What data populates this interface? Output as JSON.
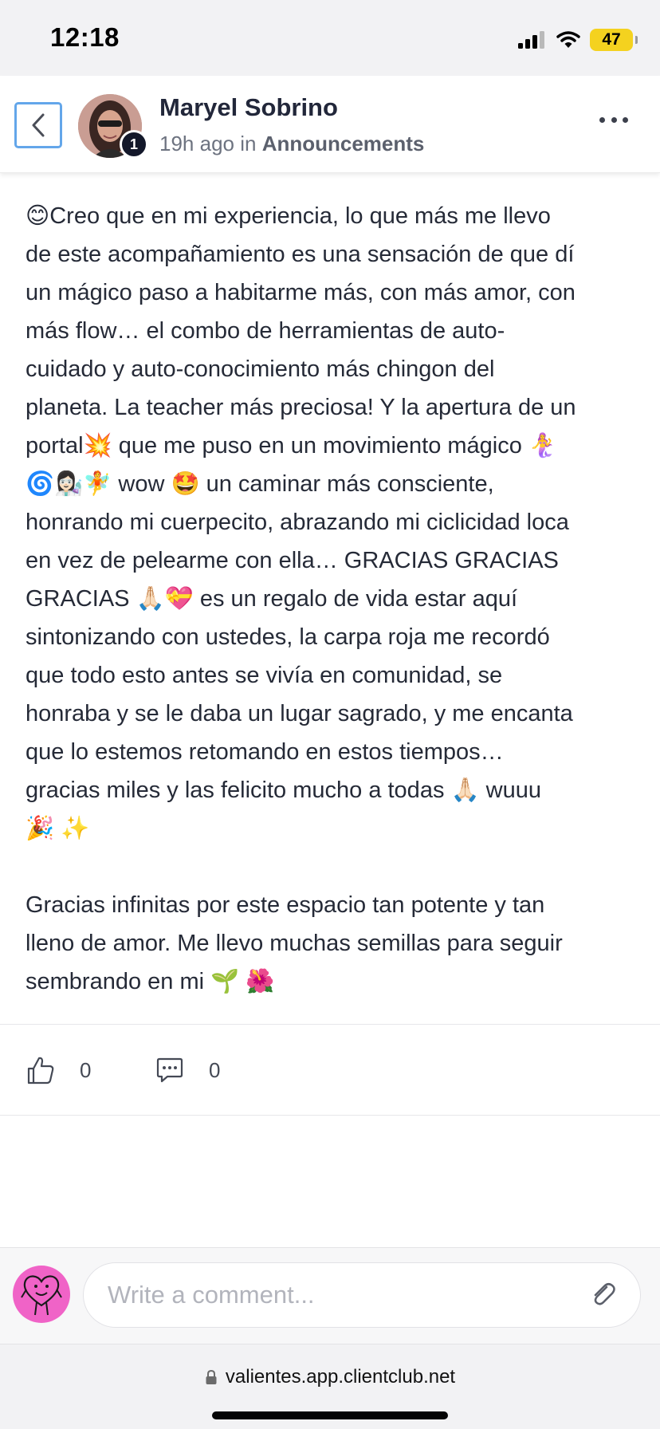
{
  "status_bar": {
    "time": "12:18",
    "battery": "47",
    "icons": [
      "signal-icon",
      "wifi-icon",
      "battery-icon"
    ]
  },
  "header": {
    "back_icon": "chevron-left-icon",
    "author_name": "Maryel Sobrino",
    "avatar_badge": "1",
    "time_ago": "19h ago",
    "in_word": "in",
    "category": "Announcements",
    "more_icon": "more-horizontal-icon"
  },
  "post": {
    "paragraphs": [
      "😊Creo que en mi experiencia, lo que más me llevo\nde este acompañamiento es una sensación de que dí\nun mágico paso a habitarme más, con más amor, con\nmás flow… el combo de herramientas de auto-\ncuidado y auto-conocimiento más chingon del\nplaneta. La teacher más preciosa! Y la apertura de un\nportal💥 que me puso en un movimiento mágico 🧜‍♀️\n🌀👩🏻‍🔬🧚 wow 🤩 un caminar más consciente,\nhonrando mi cuerpecito, abrazando mi ciclicidad loca\nen vez de pelearme con ella… GRACIAS GRACIAS\nGRACIAS 🙏🏻💝 es un regalo de vida estar aquí\nsintonizando con ustedes, la carpa roja me recordó\nque todo esto antes se vivía en comunidad, se\nhonraba y se le daba un lugar sagrado, y me encanta\nque lo estemos retomando en estos tiempos…\ngracias miles y las felicito mucho a todas 🙏🏻 wuuu\n🎉 ✨",
      "Gracias infinitas por este espacio tan potente y tan\nlleno de amor. Me llevo muchas semillas para seguir\nsembrando en mi 🌱 🌺"
    ]
  },
  "reactions": {
    "likes": "0",
    "comments": "0",
    "like_icon": "thumbs-up-icon",
    "comment_icon": "comment-icon"
  },
  "composer": {
    "placeholder": "Write a comment...",
    "attach_icon": "paperclip-icon",
    "user_avatar_icon": "heart-character-icon"
  },
  "browser": {
    "url": "valientes.app.clientclub.net",
    "lock_icon": "lock-icon"
  },
  "colors": {
    "back_button_border": "#63a6ea",
    "user_avatar_bg": "#f063c7",
    "battery": "#f4d21f"
  }
}
